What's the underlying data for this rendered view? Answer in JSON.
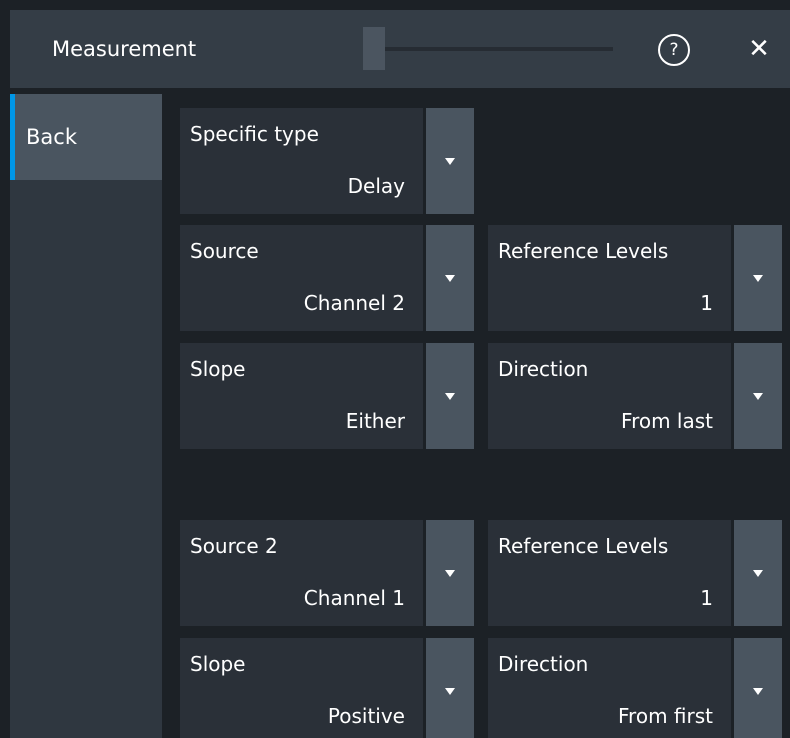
{
  "window": {
    "title": "Measurement",
    "help_icon": "help-circle-icon",
    "help_glyph": "?",
    "close_icon": "close-icon",
    "close_glyph": "✕"
  },
  "nav": {
    "back_label": "Back"
  },
  "fields": {
    "specific_type": {
      "label": "Specific type",
      "value": "Delay"
    },
    "source": {
      "label": "Source",
      "value": "Channel 2"
    },
    "ref_levels_1": {
      "label": "Reference Levels",
      "value": "1"
    },
    "slope_1": {
      "label": "Slope",
      "value": "Either"
    },
    "direction_1": {
      "label": "Direction",
      "value": "From last"
    },
    "source_2": {
      "label": "Source 2",
      "value": "Channel 1"
    },
    "ref_levels_2": {
      "label": "Reference Levels",
      "value": "1"
    },
    "slope_2": {
      "label": "Slope",
      "value": "Positive"
    },
    "direction_2": {
      "label": "Direction",
      "value": "From first"
    }
  },
  "colors": {
    "background": "#1c2126",
    "titlebar": "#343d46",
    "field": "#2a3038",
    "dropdown": "#4a5560",
    "accent": "#0096e6"
  }
}
